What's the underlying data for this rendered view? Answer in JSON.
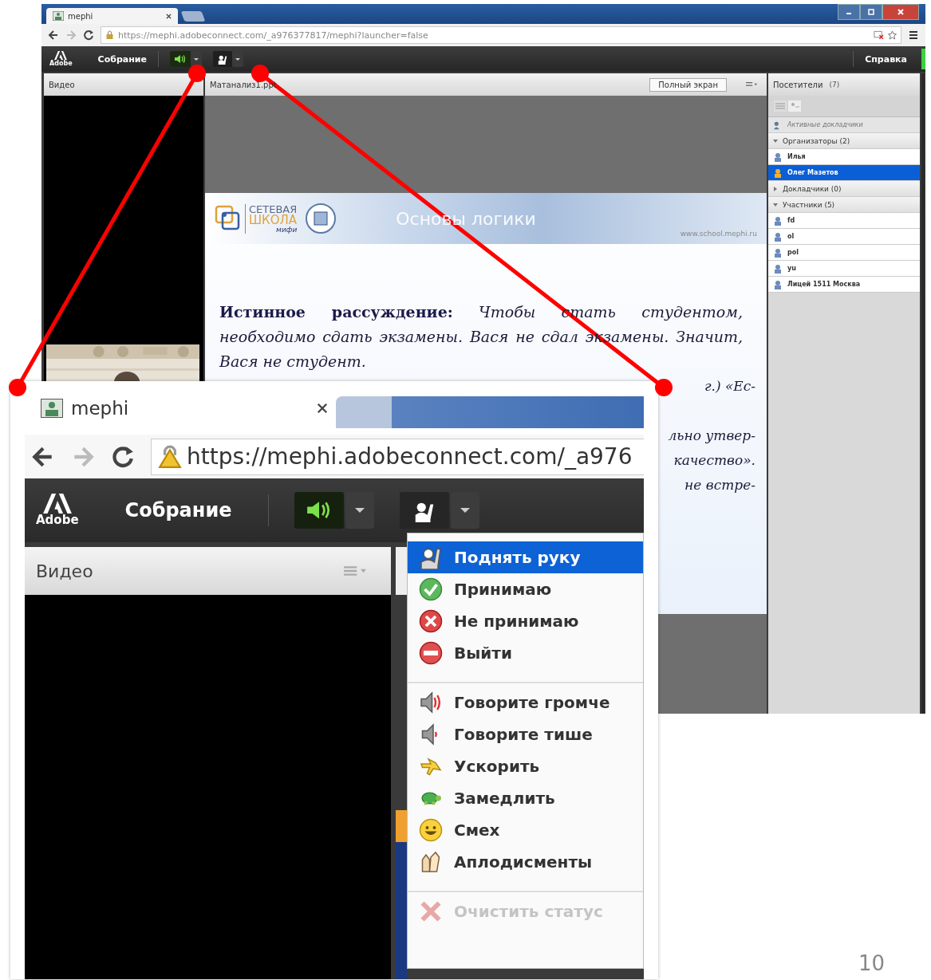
{
  "main": {
    "tab": {
      "title": "mephi"
    },
    "address": "https://mephi.adobeconnect.com/_a976377817/mephi?launcher=false",
    "toolbar": {
      "logo": "Adobe",
      "menu": "Собрание",
      "help": "Справка",
      "audio_on": true
    },
    "video": {
      "title": "Видео"
    },
    "share": {
      "title": "Матанализ1.ppt",
      "fullscreen_button": "Полный экран",
      "slide": {
        "logo_top": "СЕТЕВАЯ",
        "logo_bottom": "ШКОЛА",
        "logo_script": "мифи",
        "heading": "Основы логики",
        "site": "www.school.mephi.ru",
        "paragraph": "**Истинное рассуждение:** *Чтобы стать студентом, необходимо сдать экзамены. Вася не сдал экзамены. Значит, Вася не студент.*",
        "fragments": [
          "г.) «Ес-",
          "льно утвер-",
          "качество».",
          "не встре-"
        ]
      }
    },
    "attendees": {
      "title": "Посетители",
      "count": "(7)",
      "active_speakers": "Активные докладчики",
      "groups": [
        {
          "label": "Организаторы (2)",
          "expanded": true,
          "children": [
            {
              "name": "Илья",
              "selected": false
            },
            {
              "name": "Олег Мазетов",
              "selected": true
            }
          ]
        },
        {
          "label": "Докладчики (0)",
          "expanded": false
        },
        {
          "label": "Участники (5)",
          "expanded": true,
          "children": [
            {
              "name": "fd",
              "selected": false
            },
            {
              "name": "ol",
              "selected": false
            },
            {
              "name": "pol",
              "selected": false
            },
            {
              "name": "yu",
              "selected": false
            },
            {
              "name": "Лицей 1511 Москва",
              "selected": false
            }
          ]
        }
      ]
    }
  },
  "inset": {
    "tab": {
      "title": "mephi"
    },
    "address": "https://mephi.adobeconnect.com/_a976",
    "toolbar": {
      "logo": "Adobe",
      "menu": "Собрание",
      "audio_on": true
    },
    "video": {
      "title": "Видео"
    },
    "status_menu": {
      "groups": [
        [
          {
            "label": "Поднять руку",
            "kind": "hand",
            "selected": true,
            "disabled": false
          },
          {
            "label": "Принимаю",
            "kind": "agree",
            "selected": false,
            "disabled": false
          },
          {
            "label": "Не принимаю",
            "kind": "disagree",
            "selected": false,
            "disabled": false
          },
          {
            "label": "Выйти",
            "kind": "away",
            "selected": false,
            "disabled": false
          }
        ],
        [
          {
            "label": "Говорите громче",
            "kind": "louder",
            "selected": false,
            "disabled": false
          },
          {
            "label": "Говорите тише",
            "kind": "softer",
            "selected": false,
            "disabled": false
          },
          {
            "label": "Ускорить",
            "kind": "faster",
            "selected": false,
            "disabled": false
          },
          {
            "label": "Замедлить",
            "kind": "slower",
            "selected": false,
            "disabled": false
          },
          {
            "label": "Смех",
            "kind": "laugh",
            "selected": false,
            "disabled": false
          },
          {
            "label": "Аплодисменты",
            "kind": "applause",
            "selected": false,
            "disabled": false
          }
        ],
        [
          {
            "label": "Очистить статус",
            "kind": "clear",
            "selected": false,
            "disabled": true
          }
        ]
      ]
    }
  },
  "slide_number": "10"
}
